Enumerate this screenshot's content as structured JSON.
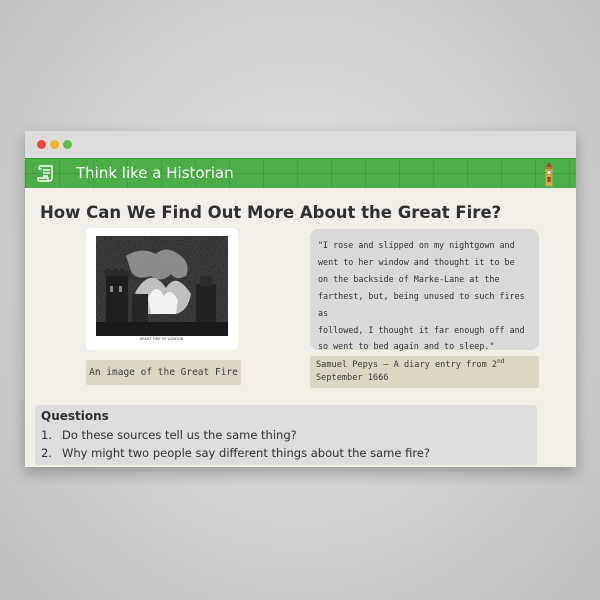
{
  "window": {
    "controls": [
      "close",
      "minimize",
      "maximize"
    ]
  },
  "banner": {
    "title": "Think like a Historian",
    "icon": "scroll-icon",
    "decoration": "clock-tower-icon",
    "color": "#4cae47"
  },
  "heading": "How Can We Find Out More About the Great Fire?",
  "sources": {
    "image": {
      "alt": "Engraving of the Great Fire of London",
      "inner_caption": "GREAT FIRE OF LONDON.",
      "caption": "An image of the Great Fire"
    },
    "quote": {
      "lines": [
        "\"I rose and slipped on my nightgown and",
        "went to her window and thought it to be",
        "on the backside of Marke-Lane at the",
        "farthest, but, being unused to such fires as",
        "followed, I thought it far enough off and",
        "so went to bed again and to sleep.\""
      ],
      "attribution_before": "Samuel Pepys – A diary entry from 2",
      "attribution_sup": "nd",
      "attribution_after": "September 1666"
    }
  },
  "questions": {
    "title": "Questions",
    "items": [
      {
        "num": "1.",
        "text": "Do these sources tell us the same thing?"
      },
      {
        "num": "2.",
        "text": "Why might two people say different things about the same fire?"
      }
    ]
  }
}
